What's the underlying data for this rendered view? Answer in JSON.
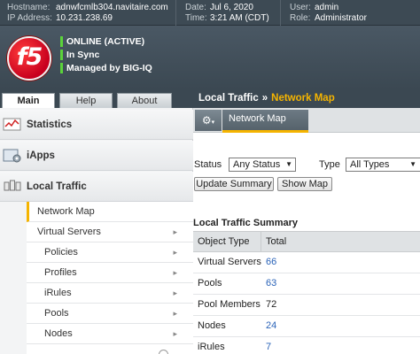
{
  "topbar": {
    "hostname_label": "Hostname:",
    "hostname": "adnwfcmlb304.navitaire.com",
    "ip_label": "IP Address:",
    "ip": "10.231.238.69",
    "date_label": "Date:",
    "date": "Jul 6, 2020",
    "time_label": "Time:",
    "time": "3:21 AM (CDT)",
    "user_label": "User:",
    "user": "admin",
    "role_label": "Role:",
    "role": "Administrator"
  },
  "header": {
    "logo_text": "f5",
    "status": [
      "ONLINE (ACTIVE)",
      "In Sync",
      "Managed by BIG-IQ"
    ],
    "status_color": "#5bd33a"
  },
  "nav": {
    "tabs": [
      {
        "label": "Main",
        "active": true
      },
      {
        "label": "Help",
        "active": false
      },
      {
        "label": "About",
        "active": false
      }
    ]
  },
  "sidebar": {
    "categories": [
      {
        "label": "Statistics",
        "icon": "statistics-icon"
      },
      {
        "label": "iApps",
        "icon": "iapps-icon"
      },
      {
        "label": "Local Traffic",
        "icon": "local-traffic-icon"
      }
    ],
    "items": [
      {
        "label": "Network Map",
        "active": true,
        "level": 1
      },
      {
        "label": "Virtual Servers",
        "level": 1
      },
      {
        "label": "Policies",
        "level": 2
      },
      {
        "label": "Profiles",
        "level": 2
      },
      {
        "label": "iRules",
        "level": 2
      },
      {
        "label": "Pools",
        "level": 1
      },
      {
        "label": "Nodes",
        "level": 1
      }
    ]
  },
  "breadcrumb": {
    "parent": "Local Traffic",
    "separator": "»",
    "current": "Network Map"
  },
  "toolbar": {
    "tab_label": "Network Map"
  },
  "filters": {
    "status_label": "Status",
    "status_value": "Any Status",
    "type_label": "Type",
    "type_value": "All Types",
    "update_button": "Update Summary",
    "show_map_button": "Show Map"
  },
  "summary": {
    "title": "Local Traffic Summary",
    "headers": [
      "Object Type",
      "Total"
    ],
    "rows": [
      {
        "type": "Virtual Servers",
        "total": "66"
      },
      {
        "type": "Pools",
        "total": "63"
      },
      {
        "type": "Pool Members",
        "total": "72"
      },
      {
        "type": "Nodes",
        "total": "24"
      },
      {
        "type": "iRules",
        "total": "7"
      }
    ]
  },
  "colors": {
    "accent": "#f5b400",
    "link": "#2a63b8",
    "header_bg": "#3b4852"
  }
}
